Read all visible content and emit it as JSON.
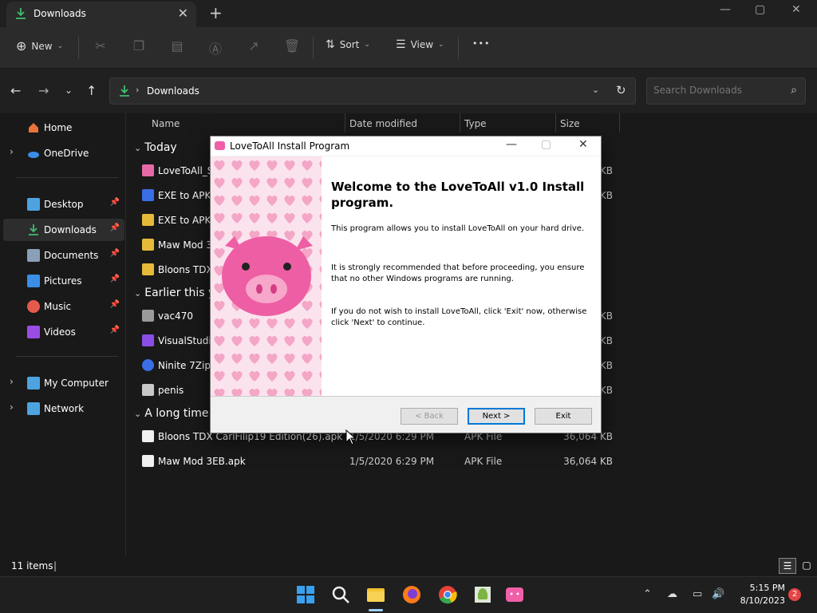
{
  "window": {
    "tab_title": "Downloads",
    "new_tab": "+",
    "controls": {
      "minimize": "—",
      "maximize": "▢",
      "close": "✕"
    }
  },
  "toolbar": {
    "new_label": "New",
    "sort_label": "Sort",
    "view_label": "View",
    "more_label": "•••"
  },
  "address": {
    "crumb": "Downloads",
    "search_placeholder": "Search Downloads"
  },
  "sidebar": {
    "items": [
      {
        "label": "Home",
        "color": "#e8743b"
      },
      {
        "label": "OneDrive",
        "color": "#3a8ee6"
      },
      {
        "label": "Desktop",
        "color": "#4da3e0"
      },
      {
        "label": "Downloads",
        "color": "#3fbf6f"
      },
      {
        "label": "Documents",
        "color": "#8aa0b8"
      },
      {
        "label": "Pictures",
        "color": "#3a8ee6"
      },
      {
        "label": "Music",
        "color": "#e65a4d"
      },
      {
        "label": "Videos",
        "color": "#9a4de6"
      },
      {
        "label": "My Computer",
        "color": "#4da3e0"
      },
      {
        "label": "Network",
        "color": "#4da3e0"
      }
    ]
  },
  "columns": {
    "name": "Name",
    "date": "Date modified",
    "type": "Type",
    "size": "Size"
  },
  "groups": {
    "today": "Today",
    "earlier": "Earlier this year",
    "longtime": "A long time ago"
  },
  "files": [
    {
      "name": "LoveToAll_Setup.exe",
      "size": "KB",
      "color": "#e66aa8"
    },
    {
      "name": "EXE to APK Converter",
      "size": "KB",
      "color": "#3a6ee6"
    },
    {
      "name": "EXE to APK Converter Tool",
      "size": "",
      "color": "#e6b93a"
    },
    {
      "name": "Maw Mod 3EB",
      "size": "",
      "color": "#e6b93a"
    },
    {
      "name": "Bloons TDX CarlFilip19 Edition",
      "size": "",
      "color": "#e6b93a"
    },
    {
      "name": "vac470",
      "size": "KB",
      "color": "#9a9a9a"
    },
    {
      "name": "VisualStudioSetup.exe",
      "size": "KB",
      "color": "#8a4de6"
    },
    {
      "name": "Ninite 7Zip Chrome Installer.exe",
      "size": "KB",
      "color": "#3a6ee6"
    },
    {
      "name": "penis",
      "size": "KB",
      "color": "#c8c8c8"
    },
    {
      "name": "Bloons TDX CarlFilip19 Edition(26).apk",
      "date": "1/5/2020 6:29 PM",
      "type": "APK File",
      "size": "36,064 KB",
      "color": "#f0f0f0"
    },
    {
      "name": "Maw Mod 3EB.apk",
      "date": "1/5/2020 6:29 PM",
      "type": "APK File",
      "size": "36,064 KB",
      "color": "#f0f0f0"
    }
  ],
  "status": {
    "count": "11 items"
  },
  "dialog": {
    "title": "LoveToAll Install Program",
    "heading": "Welcome to the LoveToAll v1.0 Install program.",
    "p1": "This program allows you to install LoveToAll on your hard drive.",
    "p2": "It is strongly recommended that before proceeding, you ensure that no other Windows programs are running.",
    "p3": "If you do not wish to install LoveToAll, click 'Exit' now, otherwise click 'Next' to continue.",
    "back": "< Back",
    "next": "Next >",
    "exit": "Exit",
    "accent": "#f05fa8"
  },
  "taskbar": {
    "time": "5:15 PM",
    "date": "8/10/2023",
    "notifications": "2"
  }
}
